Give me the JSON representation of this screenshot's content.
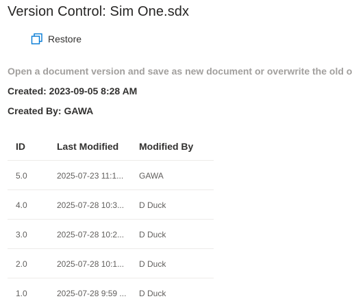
{
  "title": "Version Control: Sim One.sdx",
  "toolbar": {
    "restore_label": "Restore",
    "restore_icon": "restore-icon",
    "accent_color": "#0078d4"
  },
  "description": "Open a document version and save as new document or overwrite the old one.",
  "created": "Created: 2023-09-05 8:28 AM",
  "created_by": "Created By: GAWA",
  "table": {
    "columns": [
      "ID",
      "Last Modified",
      "Modified By"
    ],
    "rows": [
      {
        "id": "5.0",
        "modified": "2025-07-23 11:1...",
        "by": "GAWA"
      },
      {
        "id": "4.0",
        "modified": "2025-07-28 10:3...",
        "by": "D Duck"
      },
      {
        "id": "3.0",
        "modified": "2025-07-28 10:2...",
        "by": "D Duck"
      },
      {
        "id": "2.0",
        "modified": "2025-07-28 10:1...",
        "by": "D Duck"
      },
      {
        "id": "1.0",
        "modified": "2025-07-28 9:59 ...",
        "by": "D Duck"
      }
    ]
  }
}
